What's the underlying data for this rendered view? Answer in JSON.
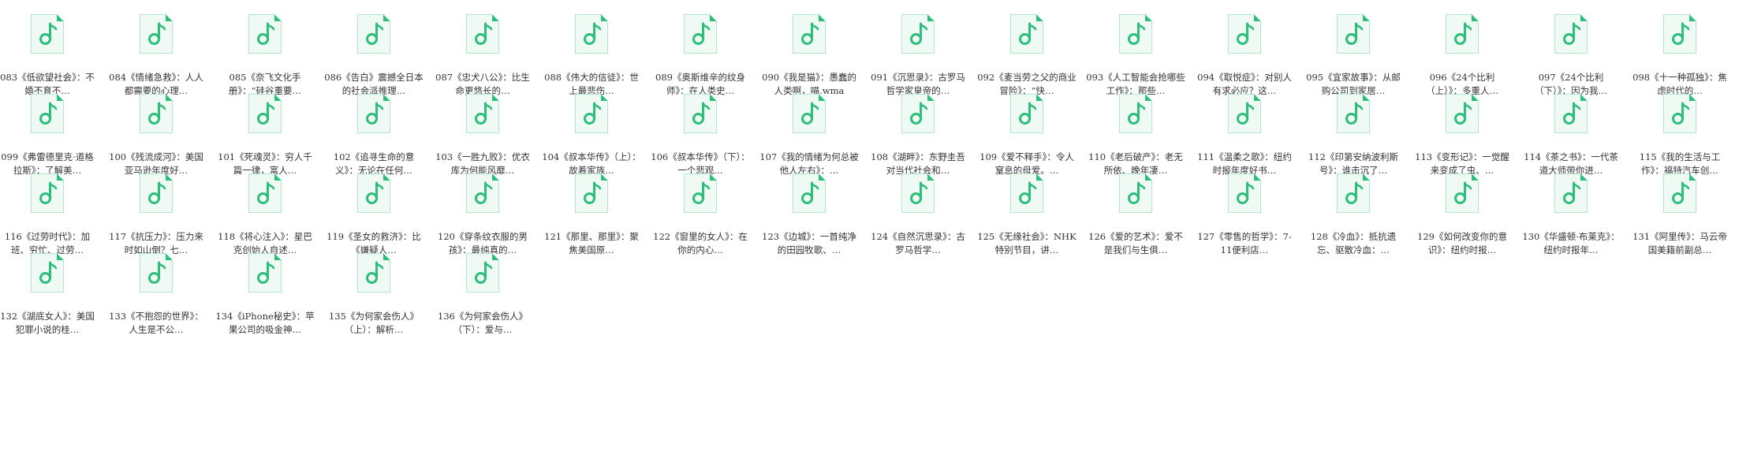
{
  "colors": {
    "icon_accent": "#2dbe7c",
    "icon_paper": "#eefaf3",
    "icon_border": "#b5e6ca",
    "text": "#333333",
    "background": "#ffffff"
  },
  "file_icon": "music-file-icon",
  "files": [
    {
      "name": "083《低欲望社会》：不婚不育不…"
    },
    {
      "name": "084《情绪急救》：人人都需要的心理…"
    },
    {
      "name": "085《奈飞文化手册》：“硅谷重要…"
    },
    {
      "name": "086《告白》震撼全日本的社会派推理…"
    },
    {
      "name": "087《忠犬八公》：比生命更悠长的…"
    },
    {
      "name": "088《伟大的信徒》：世上最悲伤…"
    },
    {
      "name": "089《奥斯维辛的纹身师》：在人类史…"
    },
    {
      "name": "090《我是猫》：愚蠢的人类啊，喵.wma"
    },
    {
      "name": "091《沉思录》：古罗马哲学家皇帝的…"
    },
    {
      "name": "092《麦当劳之父的商业冒险》：“快…"
    },
    {
      "name": "093《人工智能会抢哪些工作》：那些…"
    },
    {
      "name": "094《取悦症》：对别人有求必应？这…"
    },
    {
      "name": "095《宜家故事》：从邮购公司到家居…"
    },
    {
      "name": "096《24个比利（上）》：多重人…"
    },
    {
      "name": "097《24个比利（下）》：因为我…"
    },
    {
      "name": "098《十一种孤独》：焦虑时代的…"
    },
    {
      "name": "099《弗雷德里克·道格拉斯》：了解美…"
    },
    {
      "name": "100《残流成河》：美国亚马逊年度好…"
    },
    {
      "name": "101《死魂灵》：穷人千篇一律，富人…"
    },
    {
      "name": "102《追寻生命的意义》：无论在任何…"
    },
    {
      "name": "103《一胜九败》：优衣库为何能风靡…"
    },
    {
      "name": "104《叔本华传》（上）：故着家族…"
    },
    {
      "name": "106《叔本华传》（下）：一个悲观…"
    },
    {
      "name": "107《我的情绪为何总被他人左右》：…"
    },
    {
      "name": "108《湖畔》：东野圭吾对当代社会和…"
    },
    {
      "name": "109《爱不释手》：令人窒息的母爱。…"
    },
    {
      "name": "110《老后破产》：老无所依、晚年凄…"
    },
    {
      "name": "111《温柔之歌》：纽约时报年度好书…"
    },
    {
      "name": "112《印第安纳波利斯号》：谁击沉了…"
    },
    {
      "name": "113《变形记》：一觉醒来变成了虫、…"
    },
    {
      "name": "114《茶之书》：一代茶道大师带你进…"
    },
    {
      "name": "115《我的生活与工作》：福特汽车创…"
    },
    {
      "name": "116《过劳时代》：加班、穷忙、过劳…"
    },
    {
      "name": "117《抗压力》：压力来时如山倒？七…"
    },
    {
      "name": "118《将心注入》：星巴克创始人自述…"
    },
    {
      "name": "119《圣女的救济》：比《嫌疑人…"
    },
    {
      "name": "120《穿条纹衣服的男孩》：最纯真的…"
    },
    {
      "name": "121《那里、那里》：聚焦美国原…"
    },
    {
      "name": "122《窗里的女人》：在你的内心…"
    },
    {
      "name": "123《边城》：一首纯净的田园牧歌、…"
    },
    {
      "name": "124《自然沉思录》：古罗马哲学…"
    },
    {
      "name": "125《无缘社会》：NHK特别节目，讲…"
    },
    {
      "name": "126《爱的艺术》：爱不是我们与生俱…"
    },
    {
      "name": "127《零售的哲学》：7-11便利店…"
    },
    {
      "name": "128《冷血》：抵抗遗忘、驱散冷血：…"
    },
    {
      "name": "129《如何改变你的意识》：纽约时报…"
    },
    {
      "name": "130《华盛顿·布莱克》：纽约时报年…"
    },
    {
      "name": "131《阿里传》：马云帝国美籍前副总…"
    },
    {
      "name": "132《湖底女人》：美国犯罪小说的桂…"
    },
    {
      "name": "133《不抱怨的世界》：人生是不公…"
    },
    {
      "name": "134《iPhone秘史》：苹果公司的吸金神…"
    },
    {
      "name": "135《为何家会伤人》（上）：解析…"
    },
    {
      "name": "136《为何家会伤人》（下）：爱与…"
    }
  ]
}
